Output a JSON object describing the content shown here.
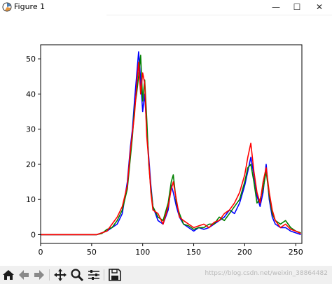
{
  "window": {
    "title": "Figure 1",
    "minimize_glyph": "—",
    "maximize_glyph": "☐",
    "close_glyph": "✕"
  },
  "toolbar": {
    "items": [
      "home-icon",
      "back-icon",
      "forward-icon",
      "pan-icon",
      "zoom-icon",
      "configure-subplots-icon",
      "save-icon"
    ],
    "status_text": "https://blog.csdn.net/weixin_38864482"
  },
  "chart_data": {
    "type": "line",
    "title": "",
    "xlabel": "",
    "ylabel": "",
    "xlim": [
      0,
      256
    ],
    "ylim": [
      -2.5,
      54
    ],
    "xticks": [
      0,
      50,
      100,
      150,
      200,
      250
    ],
    "yticks": [
      0,
      10,
      20,
      30,
      40,
      50
    ],
    "grid": false,
    "series": [
      {
        "color": "#0000ff",
        "points": [
          [
            0,
            0
          ],
          [
            55,
            0
          ],
          [
            60,
            0.5
          ],
          [
            65,
            1
          ],
          [
            70,
            2
          ],
          [
            75,
            3
          ],
          [
            80,
            6
          ],
          [
            85,
            15
          ],
          [
            88,
            25
          ],
          [
            90,
            30
          ],
          [
            92,
            38
          ],
          [
            94,
            45
          ],
          [
            96,
            52
          ],
          [
            98,
            44
          ],
          [
            100,
            35
          ],
          [
            102,
            40
          ],
          [
            104,
            30
          ],
          [
            106,
            22
          ],
          [
            108,
            14
          ],
          [
            110,
            8
          ],
          [
            115,
            4
          ],
          [
            120,
            3
          ],
          [
            125,
            7
          ],
          [
            128,
            14
          ],
          [
            130,
            12
          ],
          [
            133,
            8
          ],
          [
            136,
            5
          ],
          [
            140,
            3
          ],
          [
            145,
            2
          ],
          [
            150,
            1
          ],
          [
            155,
            2
          ],
          [
            160,
            1.5
          ],
          [
            165,
            2
          ],
          [
            170,
            3
          ],
          [
            175,
            4
          ],
          [
            180,
            5
          ],
          [
            185,
            7
          ],
          [
            190,
            6
          ],
          [
            195,
            9
          ],
          [
            200,
            14
          ],
          [
            203,
            18
          ],
          [
            206,
            22
          ],
          [
            209,
            17
          ],
          [
            212,
            11
          ],
          [
            215,
            8
          ],
          [
            218,
            12
          ],
          [
            221,
            20
          ],
          [
            224,
            10
          ],
          [
            227,
            5
          ],
          [
            230,
            3
          ],
          [
            235,
            2
          ],
          [
            240,
            2
          ],
          [
            245,
            1
          ],
          [
            250,
            0.5
          ],
          [
            255,
            0
          ]
        ]
      },
      {
        "color": "#008000",
        "points": [
          [
            0,
            0
          ],
          [
            55,
            0
          ],
          [
            60,
            0.3
          ],
          [
            65,
            1.5
          ],
          [
            70,
            2
          ],
          [
            75,
            4
          ],
          [
            80,
            7
          ],
          [
            85,
            13
          ],
          [
            88,
            22
          ],
          [
            90,
            28
          ],
          [
            92,
            36
          ],
          [
            94,
            40
          ],
          [
            96,
            45
          ],
          [
            98,
            51
          ],
          [
            100,
            38
          ],
          [
            102,
            44
          ],
          [
            104,
            33
          ],
          [
            106,
            20
          ],
          [
            108,
            13
          ],
          [
            110,
            8
          ],
          [
            115,
            5
          ],
          [
            120,
            4
          ],
          [
            125,
            9
          ],
          [
            128,
            15
          ],
          [
            130,
            17
          ],
          [
            133,
            9
          ],
          [
            136,
            6
          ],
          [
            140,
            3
          ],
          [
            145,
            2.5
          ],
          [
            150,
            1.5
          ],
          [
            155,
            2
          ],
          [
            160,
            2
          ],
          [
            165,
            3
          ],
          [
            170,
            3
          ],
          [
            175,
            5
          ],
          [
            180,
            4
          ],
          [
            185,
            6
          ],
          [
            190,
            8
          ],
          [
            195,
            10
          ],
          [
            200,
            15
          ],
          [
            203,
            19
          ],
          [
            206,
            20
          ],
          [
            209,
            15
          ],
          [
            212,
            9
          ],
          [
            215,
            10
          ],
          [
            218,
            13
          ],
          [
            221,
            18
          ],
          [
            224,
            11
          ],
          [
            227,
            6
          ],
          [
            230,
            4
          ],
          [
            235,
            3
          ],
          [
            240,
            4
          ],
          [
            245,
            2
          ],
          [
            250,
            1
          ],
          [
            255,
            0.5
          ]
        ]
      },
      {
        "color": "#ff0000",
        "points": [
          [
            0,
            0
          ],
          [
            55,
            0
          ],
          [
            60,
            0.5
          ],
          [
            65,
            1
          ],
          [
            70,
            3
          ],
          [
            75,
            5
          ],
          [
            80,
            8
          ],
          [
            85,
            14
          ],
          [
            88,
            24
          ],
          [
            90,
            29
          ],
          [
            92,
            34
          ],
          [
            94,
            42
          ],
          [
            96,
            49
          ],
          [
            98,
            40
          ],
          [
            100,
            46
          ],
          [
            102,
            43
          ],
          [
            104,
            28
          ],
          [
            106,
            21
          ],
          [
            108,
            12
          ],
          [
            110,
            7
          ],
          [
            115,
            6
          ],
          [
            120,
            3
          ],
          [
            125,
            8
          ],
          [
            128,
            13
          ],
          [
            130,
            15
          ],
          [
            133,
            10
          ],
          [
            136,
            5
          ],
          [
            140,
            4
          ],
          [
            145,
            3
          ],
          [
            150,
            2
          ],
          [
            155,
            2.5
          ],
          [
            160,
            3
          ],
          [
            165,
            2
          ],
          [
            170,
            3.5
          ],
          [
            175,
            4
          ],
          [
            180,
            6
          ],
          [
            185,
            7
          ],
          [
            190,
            9
          ],
          [
            195,
            12
          ],
          [
            200,
            17
          ],
          [
            203,
            22
          ],
          [
            206,
            26
          ],
          [
            209,
            18
          ],
          [
            212,
            12
          ],
          [
            215,
            9
          ],
          [
            218,
            15
          ],
          [
            221,
            19
          ],
          [
            224,
            12
          ],
          [
            227,
            7
          ],
          [
            230,
            4
          ],
          [
            235,
            2
          ],
          [
            240,
            3
          ],
          [
            245,
            1.5
          ],
          [
            250,
            1
          ],
          [
            255,
            0.3
          ]
        ]
      }
    ]
  }
}
